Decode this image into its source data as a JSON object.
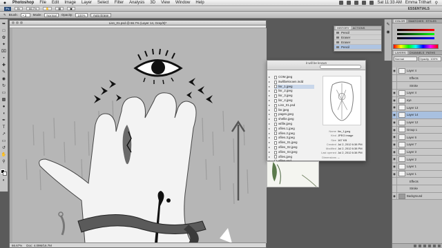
{
  "menubar": {
    "apple": "",
    "app_name": "Photoshop",
    "items": [
      "File",
      "Edit",
      "Image",
      "Layer",
      "Select",
      "Filter",
      "Analysis",
      "3D",
      "View",
      "Window",
      "Help"
    ],
    "clock": "Sat 11:33 AM",
    "user": "Emma Trithart"
  },
  "appbar": {
    "logo": "Ps",
    "zoom": "66.7%",
    "workspace": "ESSENTIALS"
  },
  "options": {
    "brush_label": "Brush:",
    "mode_label": "Mode:",
    "mode_value": "Normal",
    "opacity_label": "Opacity:",
    "opacity_value": "100%",
    "flow_label": "Flow:",
    "flow_value": "100%",
    "airbrush": "Auto Erase"
  },
  "document": {
    "title": "Lisn_01.psd @ 66.7% (Layer 14, Gray/8)*",
    "zoom_status": "66.67%",
    "doc_info": "Doc: 4.09M/16.7M"
  },
  "finder": {
    "title": "it will be known",
    "files": [
      "COM.jpeg",
      "itwillbeknown.indd",
      "lisr_1.jpeg",
      "lisr_2.jpeg",
      "lisr_3.jpeg",
      "lisr_4.jpeg",
      "Lisn_01.psd",
      "lisr.jpeg",
      "pages.jpeg",
      "shellie.jpeg",
      "wtfile.jpeg",
      "xfiles.1.jpeg",
      "xfiles.2.jpeg",
      "xfiles.3.jpeg",
      "xfiles_01.jpeg",
      "xfiles_02.jpeg",
      "xfiles_03.jpeg",
      "xfiles.jpeg",
      "xfiles.psd"
    ],
    "selected_index": 2,
    "meta": [
      {
        "k": "Name",
        "v": "lisr_1.jpeg"
      },
      {
        "k": "Kind",
        "v": "JPEG image"
      },
      {
        "k": "Size",
        "v": "167 KB"
      },
      {
        "k": "Created",
        "v": "Jul 2, 2012 6:38 PM"
      },
      {
        "k": "Modified",
        "v": "Jul 2, 2012 6:38 PM"
      },
      {
        "k": "Last opened",
        "v": "Jul 2, 2012 6:38 PM"
      },
      {
        "k": "Dimensions",
        "v": "--"
      }
    ]
  },
  "history": {
    "tabs": [
      "HISTORY",
      "ACTIONS"
    ],
    "items": [
      "Pencil",
      "Eraser",
      "Eraser",
      "Pencil"
    ],
    "selected_index": 3
  },
  "color_panel": {
    "tabs": [
      "COLOR",
      "SWATCHES",
      "STYLES"
    ]
  },
  "layers_panel": {
    "tabs": [
      "LAYERS",
      "CHANNELS",
      "PATHS"
    ],
    "blend_mode": "Normal",
    "opacity_label": "Opacity: 100%",
    "rows": [
      {
        "name": "Layer 4",
        "kind": "layer"
      },
      {
        "name": "Effects",
        "kind": "sub"
      },
      {
        "name": "Stroke",
        "kind": "sub"
      },
      {
        "name": "Layer 4",
        "kind": "layer"
      },
      {
        "name": "eye",
        "kind": "layer"
      },
      {
        "name": "Layer 13",
        "kind": "layer"
      },
      {
        "name": "Layer 14",
        "kind": "layer"
      },
      {
        "name": "Layer 12",
        "kind": "layer"
      },
      {
        "name": "Group 1",
        "kind": "layer"
      },
      {
        "name": "Layer 6",
        "kind": "layer"
      },
      {
        "name": "Layer 7",
        "kind": "layer"
      },
      {
        "name": "Layer 3",
        "kind": "layer"
      },
      {
        "name": "Layer 2",
        "kind": "layer"
      },
      {
        "name": "Layer 1",
        "kind": "layer"
      },
      {
        "name": "Layer 1",
        "kind": "layer"
      },
      {
        "name": "Effects",
        "kind": "sub"
      },
      {
        "name": "Stroke",
        "kind": "sub"
      },
      {
        "name": "Background",
        "kind": "bg"
      }
    ],
    "selected_index": 6
  },
  "colors": {
    "menubar": "#e2e2e2",
    "canvas_gray": "#b4b4b4",
    "selection_blue": "#a8c0e0"
  }
}
